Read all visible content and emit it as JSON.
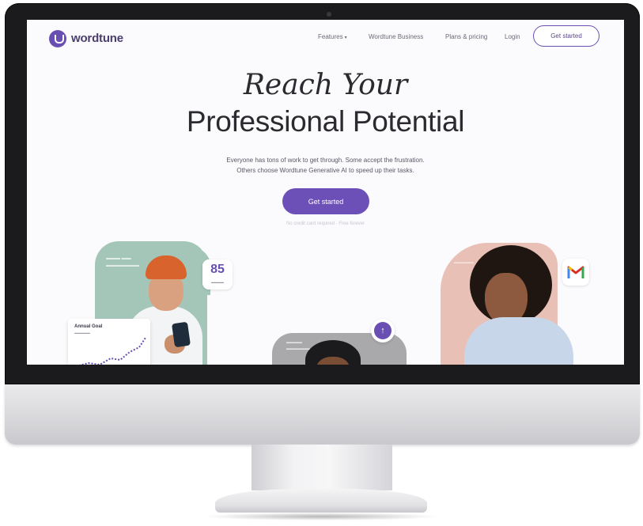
{
  "brand": {
    "logo_text": "wordtune",
    "accent": "#6a4fb3"
  },
  "nav": {
    "links": [
      {
        "label": "Features",
        "has_caret": true
      },
      {
        "label": "Wordtune Business",
        "has_caret": false
      },
      {
        "label": "Plans & pricing",
        "has_caret": false
      },
      {
        "label": "Login",
        "has_caret": false
      }
    ],
    "cta_label": "Get started"
  },
  "hero": {
    "title_line1": "Reach Your",
    "title_line2": "Professional Potential",
    "subtitle_line1": "Everyone has tons of work to get through. Some accept the frustration.",
    "subtitle_line2": "Others choose Wordtune Generative AI to speed up their tasks.",
    "cta_label": "Get started",
    "note": "No credit card required · Free forever"
  },
  "cards": {
    "stat_value": "85",
    "graph_title": "Annual Goal",
    "icons": [
      "wordtune-badge-icon",
      "gmail-icon"
    ]
  },
  "colors": {
    "card_green": "#a4c6b8",
    "card_grey": "#a9a8ab",
    "card_pink": "#e8c0b5"
  }
}
